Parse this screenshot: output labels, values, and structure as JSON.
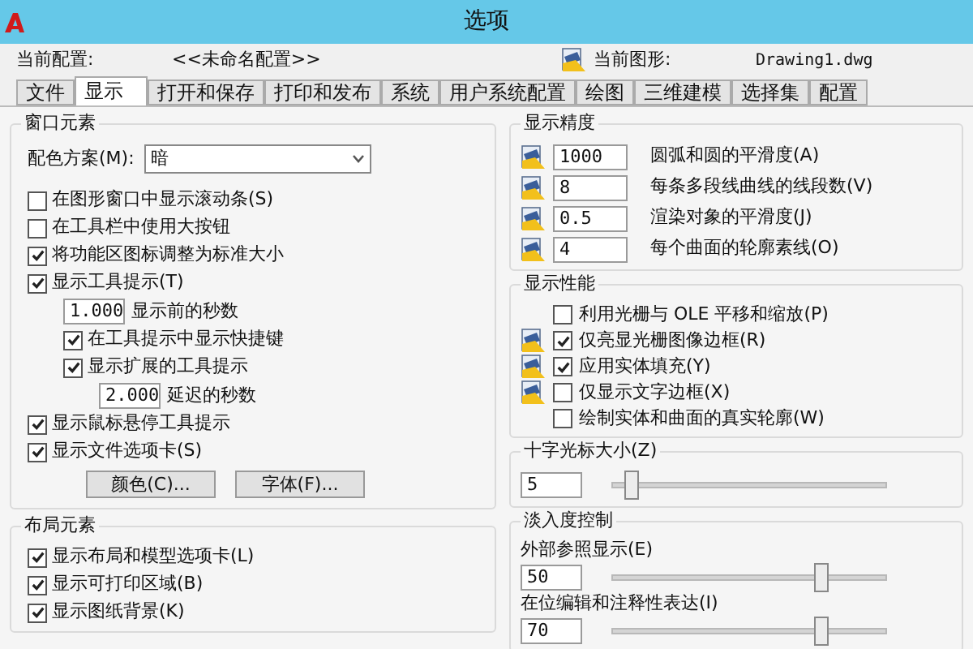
{
  "window": {
    "title": "选项"
  },
  "profile": {
    "label": "当前配置:",
    "value": "<<未命名配置>>"
  },
  "drawing": {
    "label": "当前图形:",
    "value": "Drawing1.dwg"
  },
  "tabs": [
    {
      "label": "文件",
      "selected": false
    },
    {
      "label": "显示",
      "selected": true
    },
    {
      "label": "打开和保存",
      "selected": false
    },
    {
      "label": "打印和发布",
      "selected": false
    },
    {
      "label": "系统",
      "selected": false
    },
    {
      "label": "用户系统配置",
      "selected": false
    },
    {
      "label": "绘图",
      "selected": false
    },
    {
      "label": "三维建模",
      "selected": false
    },
    {
      "label": "选择集",
      "selected": false
    },
    {
      "label": "配置",
      "selected": false
    }
  ],
  "window_elements": {
    "title": "窗口元素",
    "scheme_label": "配色方案(M):",
    "scheme_value": "暗",
    "items": [
      {
        "kind": "check",
        "label": "在图形窗口中显示滚动条(S)",
        "checked": false
      },
      {
        "kind": "check",
        "label": "在工具栏中使用大按钮",
        "checked": false
      },
      {
        "kind": "check",
        "label": "将功能区图标调整为标准大小",
        "checked": true
      },
      {
        "kind": "check",
        "label": "显示工具提示(T)",
        "checked": true,
        "children": [
          {
            "kind": "number",
            "value": "1.000",
            "label": "显示前的秒数"
          },
          {
            "kind": "check",
            "label": "在工具提示中显示快捷键",
            "checked": true
          },
          {
            "kind": "check",
            "label": "显示扩展的工具提示",
            "checked": true,
            "children": [
              {
                "kind": "number",
                "value": "2.000",
                "label": "延迟的秒数"
              }
            ]
          }
        ]
      },
      {
        "kind": "check",
        "label": "显示鼠标悬停工具提示",
        "checked": true
      },
      {
        "kind": "check",
        "label": "显示文件选项卡(S)",
        "checked": true
      }
    ],
    "buttons": [
      "颜色(C)...",
      "字体(F)..."
    ]
  },
  "layout_elements": {
    "title": "布局元素",
    "items": [
      {
        "label": "显示布局和模型选项卡(L)",
        "checked": true
      },
      {
        "label": "显示可打印区域(B)",
        "checked": true
      },
      {
        "label": "显示图纸背景(K)",
        "checked": true
      }
    ]
  },
  "resolution": {
    "title": "显示精度",
    "items": [
      {
        "value": "1000",
        "label": "圆弧和圆的平滑度(A)"
      },
      {
        "value": "8",
        "label": "每条多段线曲线的线段数(V)"
      },
      {
        "value": "0.5",
        "label": "渲染对象的平滑度(J)"
      },
      {
        "value": "4",
        "label": "每个曲面的轮廓素线(O)"
      }
    ]
  },
  "performance": {
    "title": "显示性能",
    "items": [
      {
        "label": "利用光栅与 OLE 平移和缩放(P)",
        "checked": false,
        "saved_in_drawing": false
      },
      {
        "label": "仅亮显光栅图像边框(R)",
        "checked": true,
        "saved_in_drawing": true
      },
      {
        "label": "应用实体填充(Y)",
        "checked": true,
        "saved_in_drawing": true
      },
      {
        "label": "仅显示文字边框(X)",
        "checked": false,
        "saved_in_drawing": true
      },
      {
        "label": "绘制实体和曲面的真实轮廓(W)",
        "checked": false,
        "saved_in_drawing": false
      }
    ]
  },
  "crosshair": {
    "title": "十字光标大小(Z)",
    "value": "5",
    "level": 0.07
  },
  "fade": {
    "title": "淡入度控制",
    "items": [
      {
        "label": "外部参照显示(E)",
        "value": "50",
        "level": 0.76
      },
      {
        "label": "在位编辑和注释性表达(I)",
        "value": "70",
        "level": 0.76
      }
    ]
  }
}
